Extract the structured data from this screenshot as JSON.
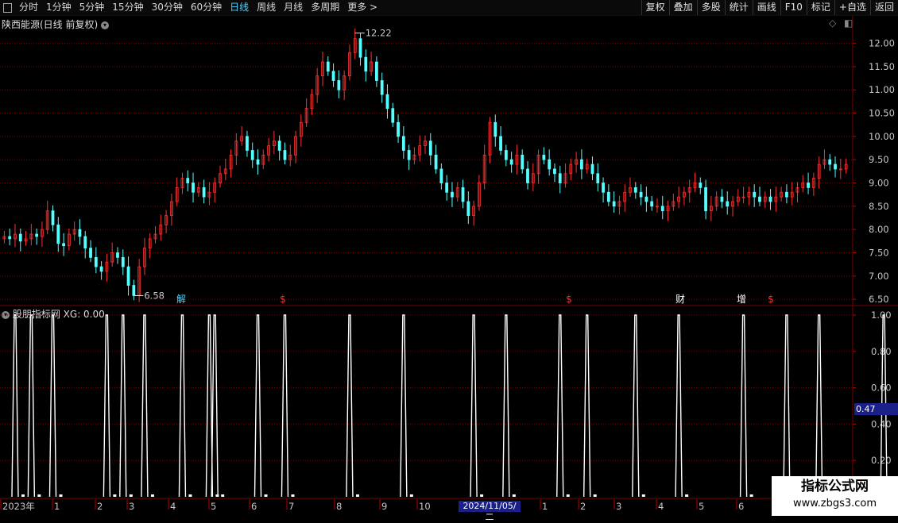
{
  "toolbar": {
    "periods": [
      "分时",
      "1分钟",
      "5分钟",
      "15分钟",
      "30分钟",
      "60分钟",
      "日线",
      "周线",
      "月线",
      "多周期",
      "更多 >"
    ],
    "active_period": "日线",
    "right_buttons": [
      "复权",
      "叠加",
      "多股",
      "统计",
      "画线",
      "F10",
      "标记",
      "+自选",
      "返回"
    ]
  },
  "main_panel": {
    "title": "陕西能源(日线 前复权)",
    "high_label": "12.22",
    "low_label": "6.58",
    "y_ticks": [
      "12.00",
      "11.50",
      "11.00",
      "10.50",
      "10.00",
      "9.50",
      "9.00",
      "8.50",
      "8.00",
      "7.50",
      "7.00",
      "6.50"
    ],
    "markers": [
      {
        "text": "解",
        "color": "#4fd4ff"
      },
      {
        "text": "$",
        "color": "#ff3030"
      },
      {
        "text": "$",
        "color": "#ff3030"
      },
      {
        "text": "财",
        "color": "#ffffff"
      },
      {
        "text": "增",
        "color": "#ffffff"
      },
      {
        "text": "$",
        "color": "#ff3030"
      }
    ]
  },
  "indicator_panel": {
    "title": "股朋指标网",
    "value_label": "XG: 0.00",
    "y_ticks": [
      "1.00",
      "0.80",
      "0.60",
      "0.40",
      "0.20"
    ],
    "current_value": "0.47"
  },
  "x_axis": {
    "labels": [
      "2023年",
      "1",
      "2",
      "3",
      "4",
      "5",
      "6",
      "7",
      "8",
      "9",
      "10",
      "2024/11/05/二",
      "1",
      "2",
      "3",
      "4",
      "5",
      "6"
    ]
  },
  "watermark": {
    "line1": "指标公式网",
    "line2": "www.zbgs3.com"
  },
  "colors": {
    "up": "#ff3030",
    "down": "#54ffff",
    "grid": "#7a0000",
    "signal": "#ffffff"
  },
  "chart_data": {
    "type": "candlestick",
    "price_range": [
      6.4,
      12.3
    ],
    "closes": [
      7.85,
      7.8,
      7.9,
      7.75,
      7.8,
      7.9,
      7.85,
      8.0,
      8.4,
      8.1,
      7.7,
      7.65,
      7.9,
      8.0,
      7.85,
      7.6,
      7.4,
      7.2,
      7.1,
      7.3,
      7.5,
      7.4,
      7.2,
      6.8,
      6.58,
      7.2,
      7.6,
      7.8,
      7.9,
      8.1,
      8.3,
      8.6,
      8.9,
      9.1,
      9.0,
      8.8,
      8.9,
      8.7,
      8.8,
      9.0,
      9.2,
      9.3,
      9.6,
      9.9,
      10.0,
      9.7,
      9.5,
      9.4,
      9.6,
      9.8,
      9.9,
      9.7,
      9.5,
      9.6,
      10.0,
      10.3,
      10.6,
      10.9,
      11.3,
      11.6,
      11.4,
      11.2,
      11.0,
      11.3,
      11.8,
      12.1,
      11.7,
      11.4,
      11.6,
      11.2,
      10.9,
      10.6,
      10.3,
      10.0,
      9.7,
      9.5,
      9.6,
      9.8,
      9.9,
      9.6,
      9.3,
      9.0,
      8.8,
      8.7,
      8.9,
      8.6,
      8.3,
      8.5,
      9.0,
      9.6,
      10.3,
      10.0,
      9.7,
      9.5,
      9.4,
      9.6,
      9.3,
      9.0,
      9.2,
      9.6,
      9.5,
      9.3,
      9.2,
      9.0,
      9.2,
      9.4,
      9.5,
      9.3,
      9.4,
      9.2,
      9.0,
      8.8,
      8.6,
      8.5,
      8.6,
      8.8,
      8.9,
      8.8,
      8.7,
      8.6,
      8.5,
      8.5,
      8.4,
      8.5,
      8.6,
      8.7,
      8.8,
      8.9,
      9.0,
      8.9,
      8.4,
      8.5,
      8.7,
      8.6,
      8.5,
      8.6,
      8.7,
      8.7,
      8.8,
      8.7,
      8.6,
      8.7,
      8.6,
      8.7,
      8.8,
      8.7,
      8.8,
      8.9,
      9.0,
      8.9,
      9.1,
      9.4,
      9.5,
      9.4,
      9.3,
      9.3,
      9.4
    ],
    "xg_signal_days": [
      2,
      5,
      9,
      19,
      22,
      26,
      33,
      38,
      39,
      47,
      52,
      64,
      74,
      87,
      93,
      103,
      108,
      117,
      125,
      137,
      145,
      151,
      163,
      172,
      178,
      180
    ]
  }
}
